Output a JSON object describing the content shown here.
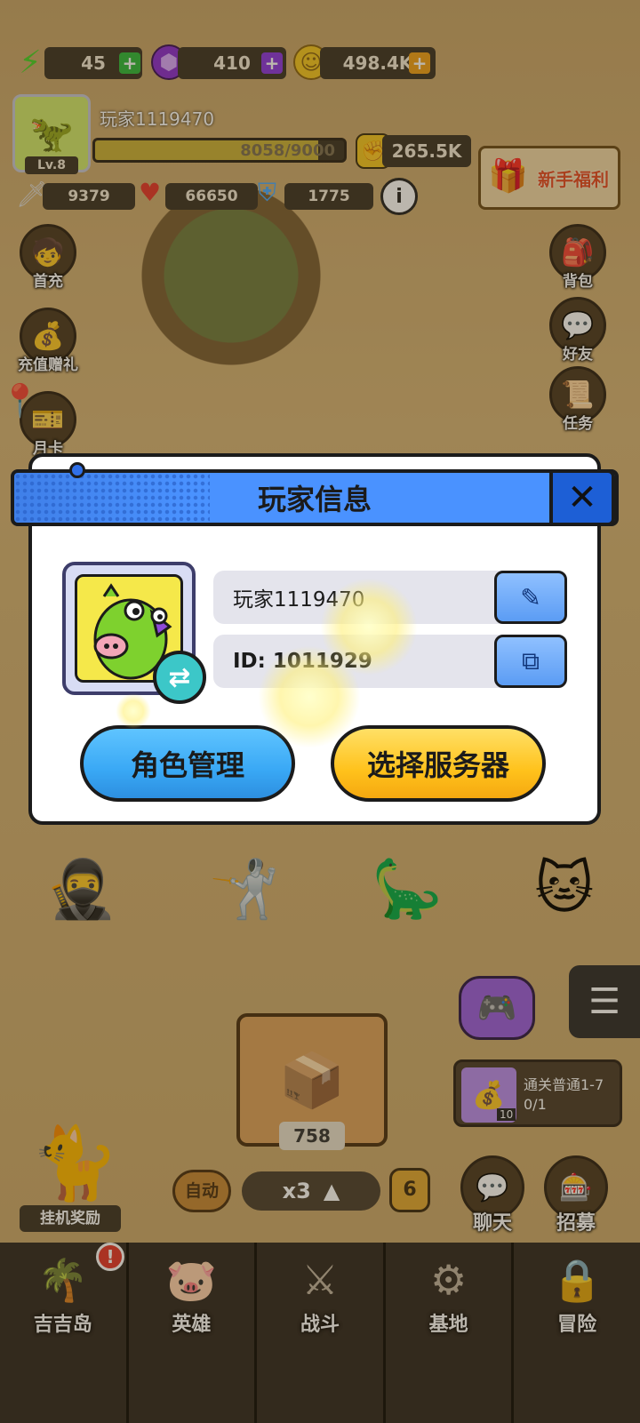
{
  "hud": {
    "energy": "45",
    "gems": "410",
    "coins": "498.4K",
    "player_name": "玩家1119470",
    "level": "Lv.8",
    "exp": "8058/9000",
    "exp_fraction": 0.8953,
    "power": "265.5K",
    "attack": "9379",
    "hp": "66650",
    "defense": "1775",
    "newbie_welfare": "新手福利"
  },
  "left_menu": [
    {
      "label": "首充",
      "icon": "first-recharge-icon"
    },
    {
      "label": "充值赠礼",
      "icon": "money-bag-icon"
    },
    {
      "label": "月卡",
      "icon": "month-card-icon"
    }
  ],
  "right_menu": [
    {
      "label": "背包",
      "icon": "backpack-icon"
    },
    {
      "label": "好友",
      "icon": "friends-icon"
    },
    {
      "label": "任务",
      "icon": "quest-scroll-icon"
    }
  ],
  "dialog": {
    "title": "玩家信息",
    "player_name": "玩家1119470",
    "player_id": "ID: 1011929",
    "role_manage_label": "角色管理",
    "select_server_label": "选择服务器"
  },
  "battle": {
    "chest_count": "758",
    "auto_label": "自动",
    "speed_label": "x3",
    "wave": "6",
    "idle_reward_label": "挂机奖励",
    "quest_title": "通关普通1-7",
    "quest_progress": "0/1",
    "quest_reward_count": "10",
    "chat_label": "聊天",
    "recruit_label": "招募"
  },
  "tabs": [
    {
      "label": "吉吉岛",
      "icon": "palm-island-icon"
    },
    {
      "label": "英雄",
      "icon": "hero-pig-icon"
    },
    {
      "label": "战斗",
      "icon": "crossed-swords-icon"
    },
    {
      "label": "基地",
      "icon": "base-gear-icon"
    },
    {
      "label": "冒险",
      "icon": "lock-icon"
    }
  ],
  "colors": {
    "dialog_header": "#4a92ff",
    "role_button": "#39a8f5",
    "server_button": "#ffc21c"
  }
}
